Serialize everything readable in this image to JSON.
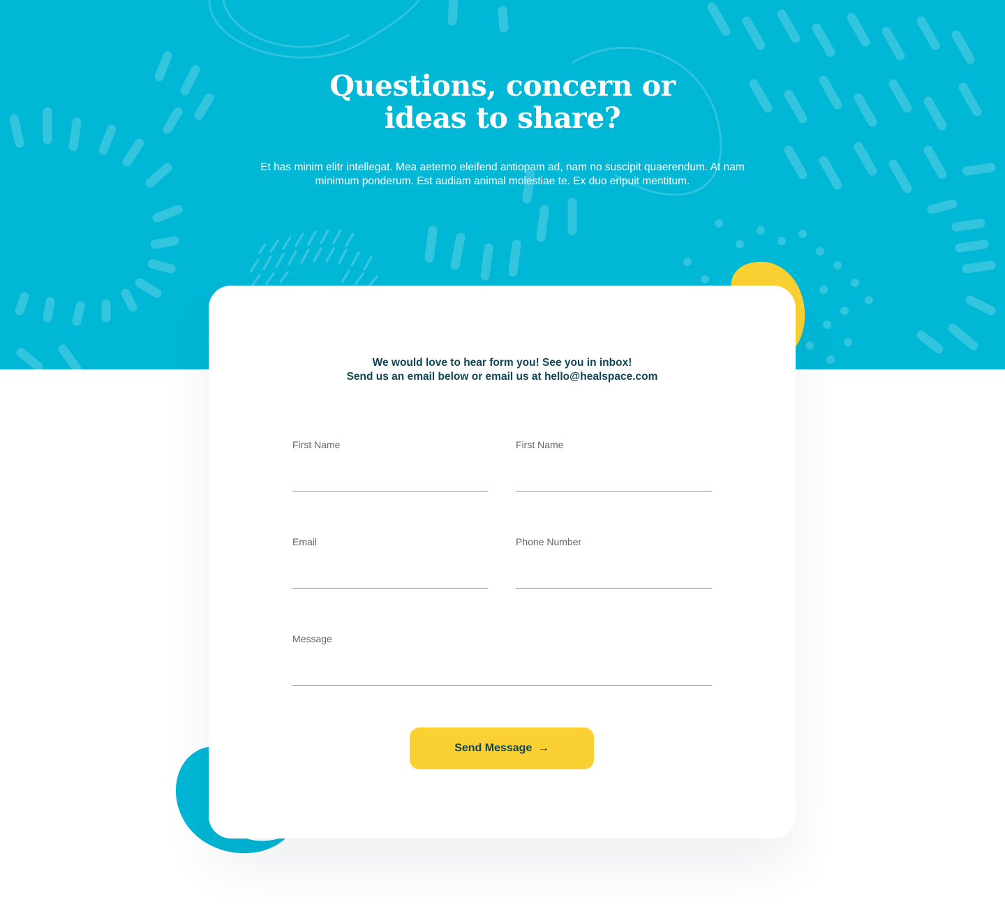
{
  "hero": {
    "title_line1": "Questions, concern or",
    "title_line2": "ideas to share?",
    "description": "Et has minim elitr intellegat. Mea aeterno eleifend antiopam ad, nam no suscipit quaerendum. At nam minimum ponderum. Est audiam animal molestiae te. Ex duo eripuit mentitum."
  },
  "form": {
    "intro_line1": "We would love to hear form you! See you in inbox!",
    "intro_line2": "Send us an email below or email us at hello@healspace.com",
    "fields": {
      "first_name_1": {
        "label": "First Name",
        "value": ""
      },
      "first_name_2": {
        "label": "First Name",
        "value": ""
      },
      "email": {
        "label": "Email",
        "value": ""
      },
      "phone": {
        "label": "Phone Number",
        "value": ""
      },
      "message": {
        "label": "Message",
        "value": ""
      }
    },
    "submit": {
      "label": "Send Message",
      "arrow": "→"
    }
  },
  "colors": {
    "hero_background": "#00b7d6",
    "accent_yellow": "#fbd033",
    "text_dark": "#0f4556",
    "label_gray": "#5e6669",
    "decor_blue": "#00b7d6"
  }
}
